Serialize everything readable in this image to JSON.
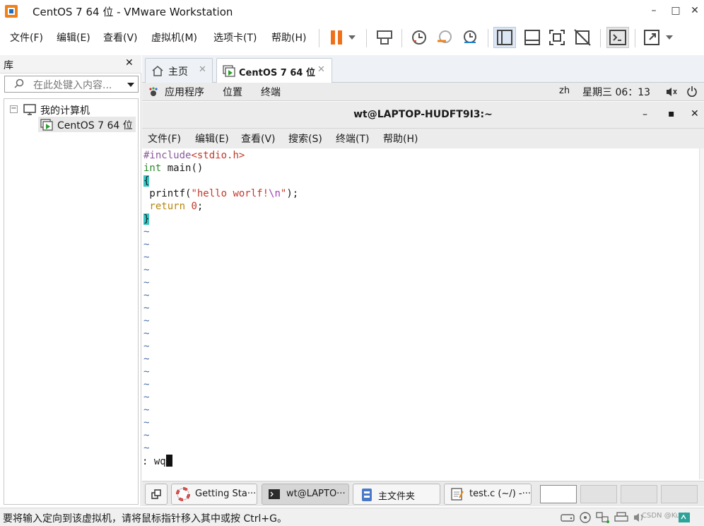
{
  "window": {
    "title": "CentOS 7 64 位 - VMware Workstation",
    "min": "–",
    "max": "□",
    "close": "✕"
  },
  "menubar": {
    "items": [
      "文件(F)",
      "编辑(E)",
      "查看(V)",
      "虚拟机(M)",
      "选项卡(T)",
      "帮助(H)"
    ]
  },
  "library": {
    "title": "库",
    "close": "✕",
    "search_placeholder": "在此处键入内容...",
    "tree_root": "我的计算机",
    "tree_vm": "CentOS 7 64 位",
    "expander": "−"
  },
  "tabs": [
    {
      "label": "主页",
      "close": "✕"
    },
    {
      "label": "CentOS 7 64 位",
      "close": "✕"
    }
  ],
  "gnome_panel": {
    "applications": "应用程序",
    "places": "位置",
    "terminal": "终端",
    "lang": "zh",
    "clock": "星期三 06：13"
  },
  "terminal": {
    "title": "wt@LAPTOP-HUDFT9I3:~",
    "min": "–",
    "max": "▪",
    "close": "✕",
    "menu": [
      "文件(F)",
      "编辑(E)",
      "查看(V)",
      "搜索(S)",
      "终端(T)",
      "帮助(H)"
    ],
    "code": {
      "include_kw": "#include",
      "include_file": "<stdio.h>",
      "int_kw": "int",
      "main_sig": " main()",
      "open_brace": "{",
      "printf_pre": " printf(",
      "string_pre": "\"hello worlf!",
      "string_esc": "\\n",
      "string_end": "\"",
      "printf_post": ");",
      "return_kw": " return",
      "return_sp": " ",
      "return_val": "0",
      "return_end": ";",
      "close_brace": "}"
    },
    "tilde": "~",
    "command": ": wq"
  },
  "taskbar": {
    "items": [
      "Getting Sta···",
      "wt@LAPTO···",
      "主文件夹",
      "test.c (~/) -···"
    ]
  },
  "statusbar": {
    "message": "要将输入定向到该虚拟机，请将鼠标指针移入其中或按 Ctrl+G。",
    "watermark": "CSDN @Kuqi"
  },
  "colors": {
    "accent_orange": "#f0701a",
    "vm_green": "#2e9e2e",
    "cursor_cyan": "#39c6c6",
    "string_red": "#c0392b"
  }
}
